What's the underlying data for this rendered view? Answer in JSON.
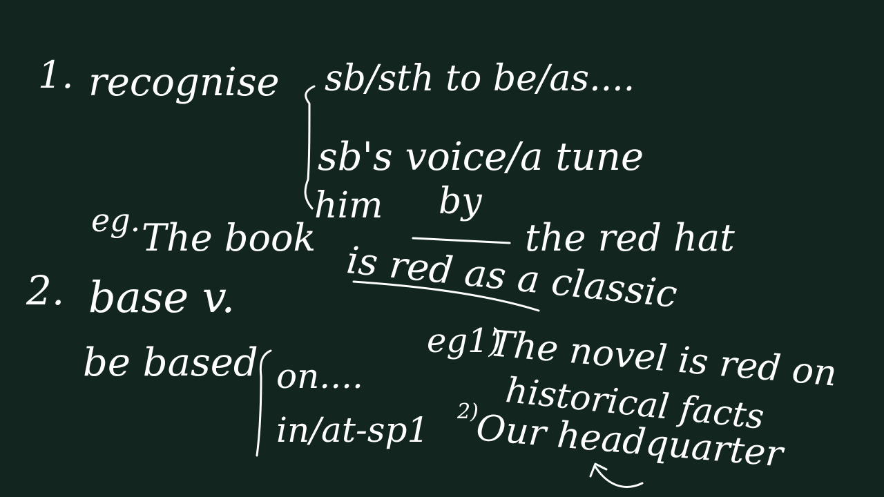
{
  "board": {
    "background": "#12261f",
    "ink": "#ffffff",
    "item1": {
      "number": "1.",
      "word": "recognise",
      "uses": [
        "sb/sth to be/as....",
        "sb's voice/a tune",
        "him"
      ],
      "prep": "by",
      "rest": "the red hat"
    },
    "example1": {
      "marker": "eg.",
      "sentence_a": "The book",
      "phrase": "is red as a classic"
    },
    "item2": {
      "number": "2.",
      "word": "base v.",
      "phrase": "be based",
      "uses": [
        "on....",
        "in/at-sp1"
      ]
    },
    "example2": {
      "marker": "eg1)",
      "line1": "The novel is red on",
      "line2": "historical facts",
      "marker2": "2)",
      "line3": "Our headquarter"
    }
  }
}
